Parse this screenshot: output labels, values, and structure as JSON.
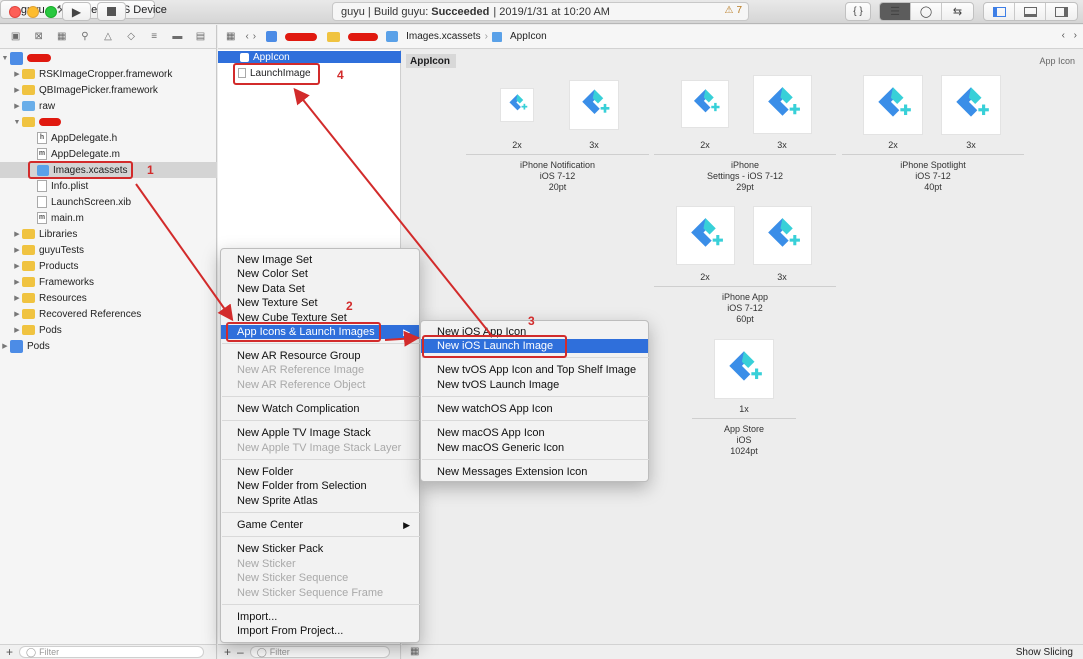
{
  "toolbar": {
    "scheme": "guyu",
    "destination": "Generic iOS Device",
    "status_prefix": "guyu | Build guyu:",
    "status_result": "Succeeded",
    "status_time": "| 2019/1/31 at 10:20 AM",
    "warning_count": "7",
    "braces_label": "{ }"
  },
  "navigator": {
    "items": [
      {
        "label": "RSKImageCropper.framework"
      },
      {
        "label": "QBImagePicker.framework"
      },
      {
        "label": "raw"
      },
      {
        "label": "AppDelegate.h"
      },
      {
        "label": "AppDelegate.m"
      },
      {
        "label": "Images.xcassets"
      },
      {
        "label": "Info.plist"
      },
      {
        "label": "LaunchScreen.xib"
      },
      {
        "label": "main.m"
      },
      {
        "label": "Libraries"
      },
      {
        "label": "guyuTests"
      },
      {
        "label": "Products"
      },
      {
        "label": "Frameworks"
      },
      {
        "label": "Resources"
      },
      {
        "label": "Recovered References"
      },
      {
        "label": "Pods"
      },
      {
        "label": "Pods"
      }
    ],
    "filter_placeholder": "Filter"
  },
  "jumpbar": {
    "crumb1": "Images.xcassets",
    "crumb2": "AppIcon"
  },
  "assetlist": {
    "items": [
      "AppIcon",
      "LaunchImage"
    ],
    "filter_placeholder": "Filter"
  },
  "editor": {
    "header": "AppIcon",
    "title": "App Icon",
    "show_slicing": "Show Slicing",
    "groups": [
      {
        "scales": [
          "2x",
          "3x"
        ],
        "lines": [
          "iPhone Notification",
          "iOS 7-12",
          "20pt"
        ]
      },
      {
        "scales": [
          "2x",
          "3x"
        ],
        "lines": [
          "iPhone",
          "Settings - iOS 7-12",
          "29pt"
        ]
      },
      {
        "scales": [
          "2x",
          "3x"
        ],
        "lines": [
          "iPhone Spotlight",
          "iOS 7-12",
          "40pt"
        ]
      },
      {
        "scales": [
          "2x",
          "3x"
        ],
        "lines": [
          "iPhone App",
          "iOS 7-12",
          "60pt"
        ]
      },
      {
        "scales": [
          "1x"
        ],
        "lines": [
          "App Store",
          "iOS",
          "1024pt"
        ]
      }
    ]
  },
  "context_menu": {
    "items": [
      {
        "label": "New Image Set",
        "enabled": true
      },
      {
        "label": "New Color Set",
        "enabled": true
      },
      {
        "label": "New Data Set",
        "enabled": true
      },
      {
        "label": "New Texture Set",
        "enabled": true
      },
      {
        "label": "New Cube Texture Set",
        "enabled": true
      },
      {
        "label": "App Icons & Launch Images",
        "enabled": true
      },
      {
        "label": "New AR Resource Group",
        "enabled": true
      },
      {
        "label": "New AR Reference Image",
        "enabled": false
      },
      {
        "label": "New AR Reference Object",
        "enabled": false
      },
      {
        "label": "New Watch Complication",
        "enabled": true
      },
      {
        "label": "New Apple TV Image Stack",
        "enabled": true
      },
      {
        "label": "New Apple TV Image Stack Layer",
        "enabled": false
      },
      {
        "label": "New Folder",
        "enabled": true
      },
      {
        "label": "New Folder from Selection",
        "enabled": true
      },
      {
        "label": "New Sprite Atlas",
        "enabled": true
      },
      {
        "label": "Game Center",
        "enabled": true
      },
      {
        "label": "New Sticker Pack",
        "enabled": true
      },
      {
        "label": "New Sticker",
        "enabled": false
      },
      {
        "label": "New Sticker Sequence",
        "enabled": false
      },
      {
        "label": "New Sticker Sequence Frame",
        "enabled": false
      },
      {
        "label": "Import...",
        "enabled": true
      },
      {
        "label": "Import From Project...",
        "enabled": true
      }
    ]
  },
  "submenu": {
    "items": [
      {
        "label": "New iOS App Icon"
      },
      {
        "label": "New iOS Launch Image"
      },
      {
        "label": "New tvOS App Icon and Top Shelf Image"
      },
      {
        "label": "New tvOS Launch Image"
      },
      {
        "label": "New watchOS App Icon"
      },
      {
        "label": "New macOS App Icon"
      },
      {
        "label": "New macOS Generic Icon"
      },
      {
        "label": "New Messages Extension Icon"
      }
    ]
  },
  "annotations": [
    "1",
    "2",
    "3",
    "4"
  ],
  "colors": {
    "highlight": "#2f6fdb",
    "annotation": "#d22b2b",
    "icon_blue": "#3a8ee8",
    "icon_cyan": "#38d0d8"
  }
}
